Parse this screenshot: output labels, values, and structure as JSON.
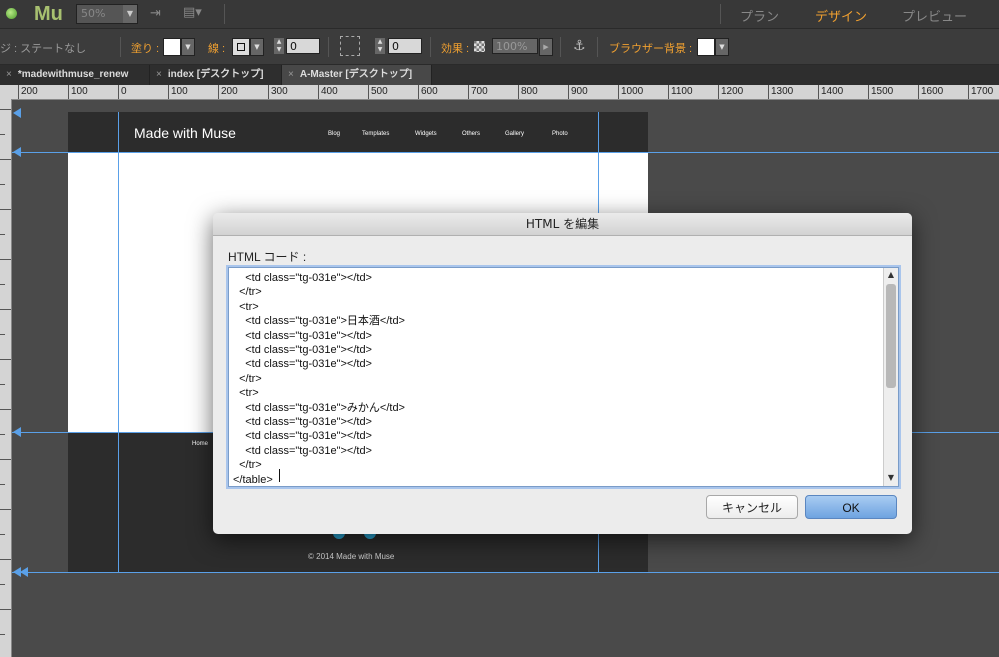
{
  "appbar": {
    "logo": "Mu",
    "zoom": "50%",
    "modes": [
      {
        "label": "プラン",
        "active": false
      },
      {
        "label": "デザイン",
        "active": true
      },
      {
        "label": "プレビュー",
        "active": false
      }
    ]
  },
  "toolbar": {
    "state_label": "ジ : ステートなし",
    "fill_label": "塗り :",
    "stroke_label": "線 :",
    "stroke_value": "0",
    "corner_value": "0",
    "effect_label": "効果 :",
    "opacity_value": "100%",
    "browser_bg_label": "ブラウザー背景 :"
  },
  "tabs": [
    {
      "label": "*madewithmuse_renew",
      "active": false
    },
    {
      "label": "index [デスクトップ]",
      "active": false
    },
    {
      "label": "A-Master [デスクトップ]",
      "active": true
    }
  ],
  "ruler": {
    "ticks": [
      "200",
      "100",
      "0",
      "100",
      "200",
      "300",
      "400",
      "500",
      "600",
      "700",
      "800",
      "900",
      "1000",
      "1100",
      "1200",
      "1300",
      "1400",
      "1500",
      "1600",
      "1700"
    ]
  },
  "page": {
    "site_title": "Made with Muse",
    "nav": [
      "Blog",
      "Templates",
      "Widgets",
      "Others",
      "Gallery",
      "Photo"
    ],
    "footer_home": "Home",
    "copyright": "© 2014 Made with Muse"
  },
  "dialog": {
    "title": "HTML を編集",
    "code_label": "HTML コード :",
    "code_lines": [
      "    <td class=\"tg-031e\"></td>",
      "  </tr>",
      "  <tr>",
      "    <td class=\"tg-031e\">日本酒</td>",
      "    <td class=\"tg-031e\"></td>",
      "    <td class=\"tg-031e\"></td>",
      "    <td class=\"tg-031e\"></td>",
      "  </tr>",
      "  <tr>",
      "    <td class=\"tg-031e\">みかん</td>",
      "    <td class=\"tg-031e\"></td>",
      "    <td class=\"tg-031e\"></td>",
      "    <td class=\"tg-031e\"></td>",
      "  </tr>",
      "</table>"
    ],
    "cancel_label": "キャンセル",
    "ok_label": "OK"
  },
  "colors": {
    "accent": "#f0a030",
    "guide": "#5aa0e8",
    "ok_button": "#6ea3e0"
  }
}
